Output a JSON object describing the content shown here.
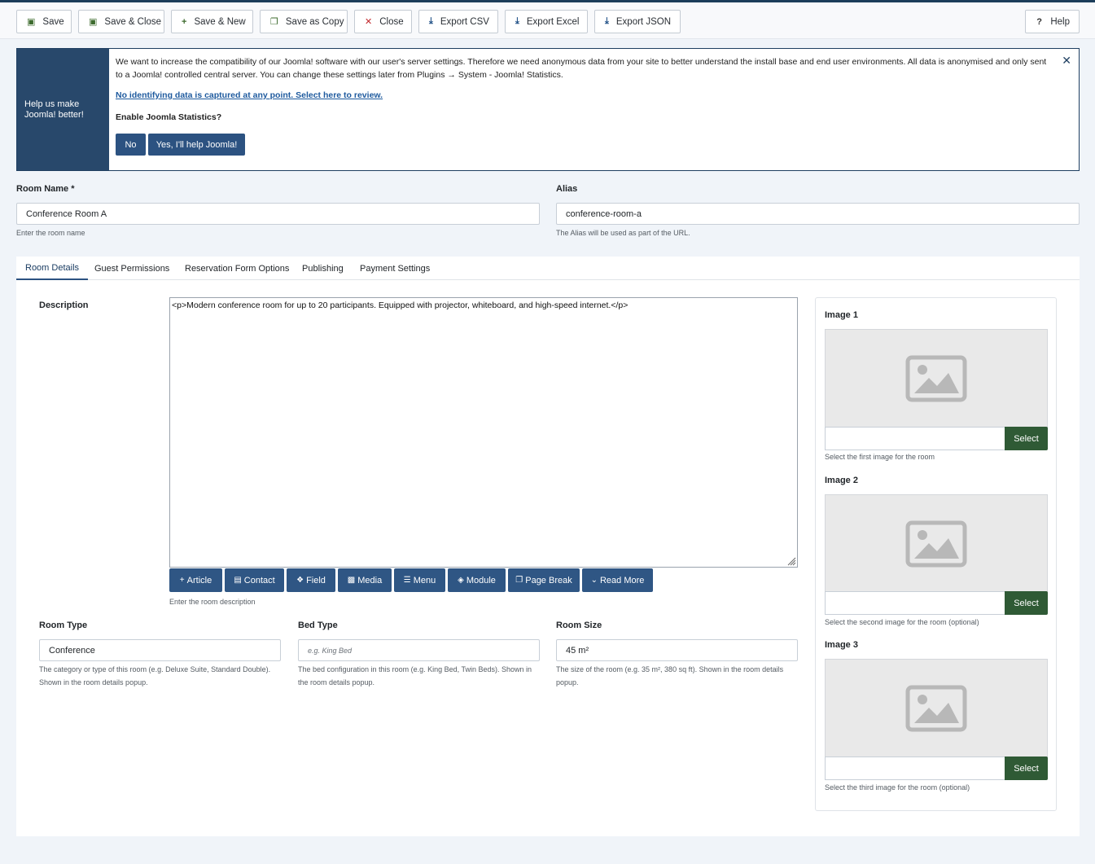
{
  "toolbar": {
    "save": "Save",
    "save_close": "Save & Close",
    "save_new": "Save & New",
    "save_copy": "Save as Copy",
    "close": "Close",
    "export_csv": "Export CSV",
    "export_excel": "Export Excel",
    "export_json": "Export JSON",
    "help": "Help"
  },
  "stats_notice": {
    "side_title": "Help us make Joomla! better!",
    "message": "We want to increase the compatibility of our Joomla! software with our user's server settings. Therefore we need anonymous data from your site to better understand the install base and end user environments. All data is anonymised and only sent to a Joomla! controlled central server. You can change these settings later from Plugins → System - Joomla! Statistics.",
    "review_link": "No identifying data is captured at any point. Select here to review.",
    "question": "Enable Joomla Statistics?",
    "no_label": "No",
    "yes_label": "Yes, I'll help Joomla!",
    "close_glyph": "✕"
  },
  "fields": {
    "room_name": {
      "label": "Room Name *",
      "value": "Conference Room A",
      "help": "Enter the room name"
    },
    "alias": {
      "label": "Alias",
      "value": "conference-room-a",
      "help": "The Alias will be used as part of the URL."
    }
  },
  "tabs": [
    "Room Details",
    "Guest Permissions",
    "Reservation Form Options",
    "Publishing",
    "Payment Settings"
  ],
  "description": {
    "label": "Description",
    "content": "<p>Modern conference room for up to 20 participants. Equipped with projector, whiteboard, and high-speed internet.</p>",
    "help": "Enter the room description",
    "buttons": [
      "Article",
      "Contact",
      "Field",
      "Media",
      "Menu",
      "Module",
      "Page Break",
      "Read More"
    ]
  },
  "room_type": {
    "label": "Room Type",
    "value": "Conference",
    "help": "The category or type of this room (e.g. Deluxe Suite, Standard Double). Shown in the room details popup."
  },
  "bed_type": {
    "label": "Bed Type",
    "placeholder": "e.g. King Bed",
    "help": "The bed configuration in this room (e.g. King Bed, Twin Beds). Shown in the room details popup."
  },
  "room_size": {
    "label": "Room Size",
    "value": "45 m²",
    "help": "The size of the room (e.g. 35 m², 380 sq ft). Shown in the room details popup."
  },
  "images": [
    {
      "label": "Image 1",
      "button": "Select",
      "help": "Select the first image for the room"
    },
    {
      "label": "Image 2",
      "button": "Select",
      "help": "Select the second image for the room (optional)"
    },
    {
      "label": "Image 3",
      "button": "Select",
      "help": "Select the third image for the room (optional)"
    }
  ],
  "colors": {
    "primary": "#2c5281",
    "notice_side": "#28486b",
    "select_button": "#2f5a35",
    "save_icon": "#3d6b2e",
    "close_icon": "#c0262b"
  }
}
